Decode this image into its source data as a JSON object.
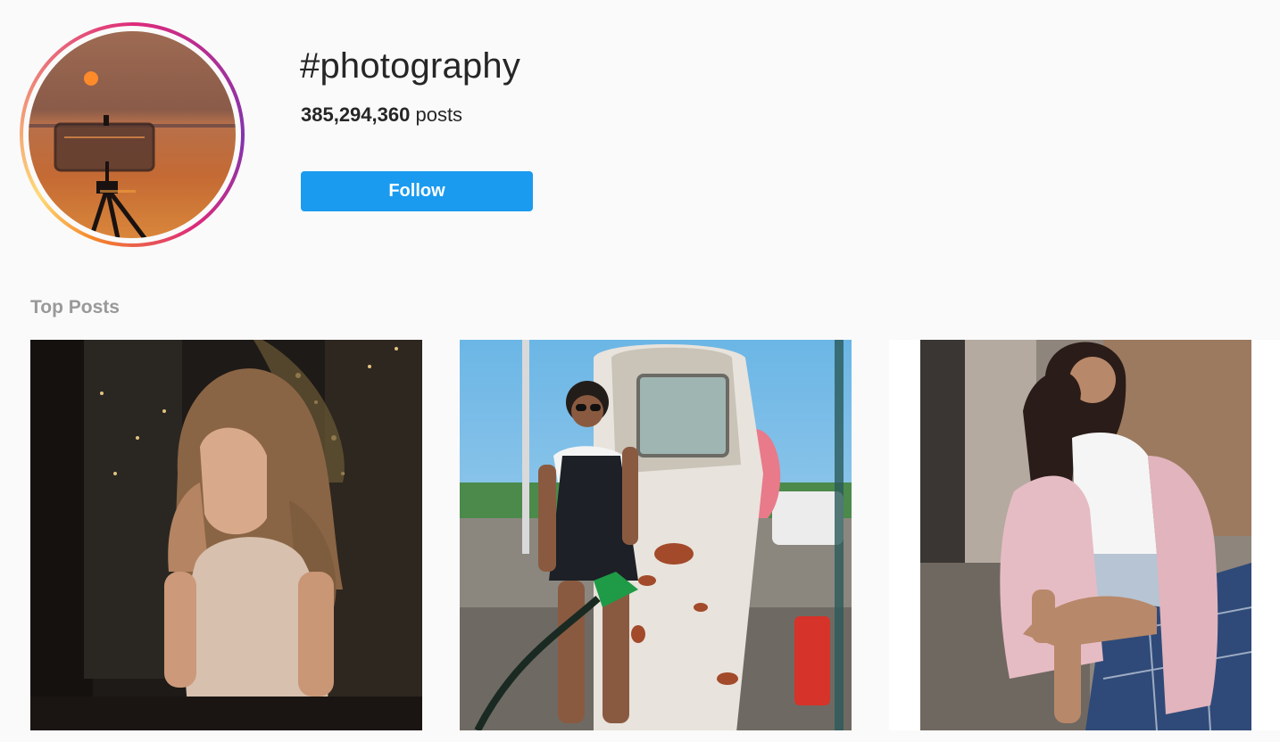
{
  "hashtag": {
    "title": "#photography",
    "posts_count": "385,294,360",
    "posts_suffix": "posts",
    "follow_label": "Follow"
  },
  "sections": {
    "top_posts_label": "Top Posts"
  },
  "colors": {
    "follow_button": "#1a9bef",
    "label_gray": "#999999",
    "background": "#fafafa"
  },
  "posts": [
    {
      "name": "post-1"
    },
    {
      "name": "post-2"
    },
    {
      "name": "post-3"
    }
  ]
}
